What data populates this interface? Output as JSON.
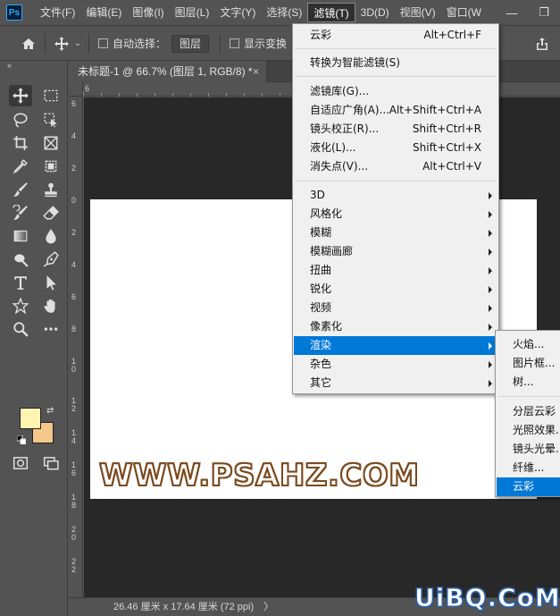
{
  "app": {
    "logo_text": "Ps"
  },
  "menubar": {
    "items": [
      "文件(F)",
      "编辑(E)",
      "图像(I)",
      "图层(L)",
      "文字(Y)",
      "选择(S)",
      "滤镜(T)",
      "3D(D)",
      "视图(V)",
      "窗口(W"
    ],
    "active": "滤镜(T)",
    "window_controls": {
      "minimize": "—",
      "restore": "❐"
    }
  },
  "options": {
    "auto_select_label": "自动选择：",
    "auto_select_value": "图层",
    "show_transform_label": "显示变换"
  },
  "document": {
    "tab_title": "未标题-1 @ 66.7% (图层 1, RGB/8) *",
    "tab_close": "×",
    "status_text": "26.46 厘米 x 17.64 厘米 (72 ppi)",
    "status_arrow": "〉"
  },
  "rulers": {
    "top_ticks": [
      "6"
    ],
    "left_ticks": [
      "6",
      "4",
      "2",
      "0",
      "2",
      "4",
      "6",
      "8",
      "1 0",
      "1 2",
      "1 4",
      "1 6",
      "1 8",
      "2 0",
      "2 2"
    ]
  },
  "colors": {
    "foreground": "#fff4b0",
    "background": "#f4c889",
    "highlight": "#0078d7"
  },
  "filter_menu": {
    "last_filter": {
      "label": "云彩",
      "shortcut": "Alt+Ctrl+F"
    },
    "convert_smart": {
      "label": "转换为智能滤镜(S)"
    },
    "group2": [
      {
        "label": "滤镜库(G)...",
        "shortcut": ""
      },
      {
        "label": "自适应广角(A)...",
        "shortcut": "Alt+Shift+Ctrl+A"
      },
      {
        "label": "镜头校正(R)...",
        "shortcut": "Shift+Ctrl+R"
      },
      {
        "label": "液化(L)...",
        "shortcut": "Shift+Ctrl+X"
      },
      {
        "label": "消失点(V)...",
        "shortcut": "Alt+Ctrl+V"
      }
    ],
    "submenus": [
      {
        "label": "3D"
      },
      {
        "label": "风格化"
      },
      {
        "label": "模糊"
      },
      {
        "label": "模糊画廊"
      },
      {
        "label": "扭曲"
      },
      {
        "label": "锐化"
      },
      {
        "label": "视频"
      },
      {
        "label": "像素化"
      },
      {
        "label": "渲染"
      },
      {
        "label": "杂色"
      },
      {
        "label": "其它"
      }
    ],
    "highlighted": "渲染"
  },
  "render_submenu": {
    "group1": [
      "火焰...",
      "图片框...",
      "树..."
    ],
    "group2": [
      "分层云彩",
      "光照效果...",
      "镜头光晕...",
      "纤维...",
      "云彩"
    ],
    "highlighted": "云彩"
  },
  "watermarks": {
    "psahz": "WWW.PSAHZ.COM",
    "uibq": "UiBQ.CoM"
  }
}
